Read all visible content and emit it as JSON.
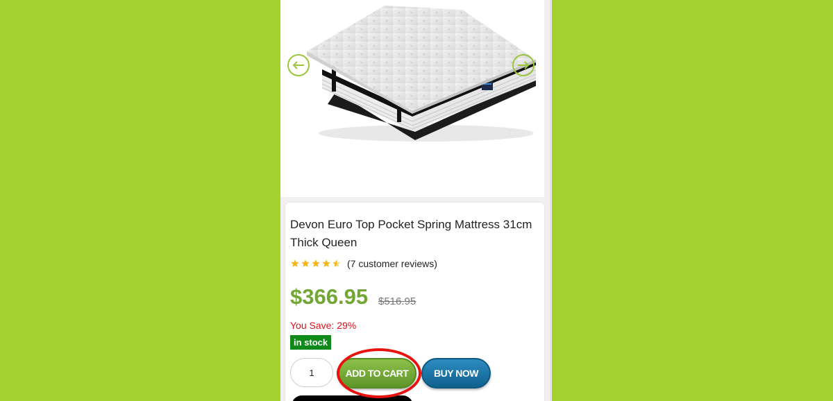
{
  "product": {
    "title": "Devon Euro Top Pocket Spring Mattress 31cm Thick Queen",
    "rating": 4.5,
    "reviews_label": "(7 customer reviews)",
    "price": "$366.95",
    "old_price": "$516.95",
    "you_save": "You Save: 29%",
    "stock": "in stock",
    "quantity": "1"
  },
  "buttons": {
    "add_to_cart": "ADD TO CART",
    "buy_now": "BUY NOW"
  },
  "colors": {
    "background": "#a4d22e",
    "price": "#72a736",
    "save": "#e0101a",
    "stock_badge": "#0f8a1a",
    "add_to_cart": "#6fa532",
    "buy_now": "#1a72a3",
    "highlight": "#e8130f",
    "star": "#f5b81c"
  },
  "icons": {
    "prev": "arrow-left-icon",
    "next": "arrow-right-icon",
    "star": "star-icon"
  }
}
